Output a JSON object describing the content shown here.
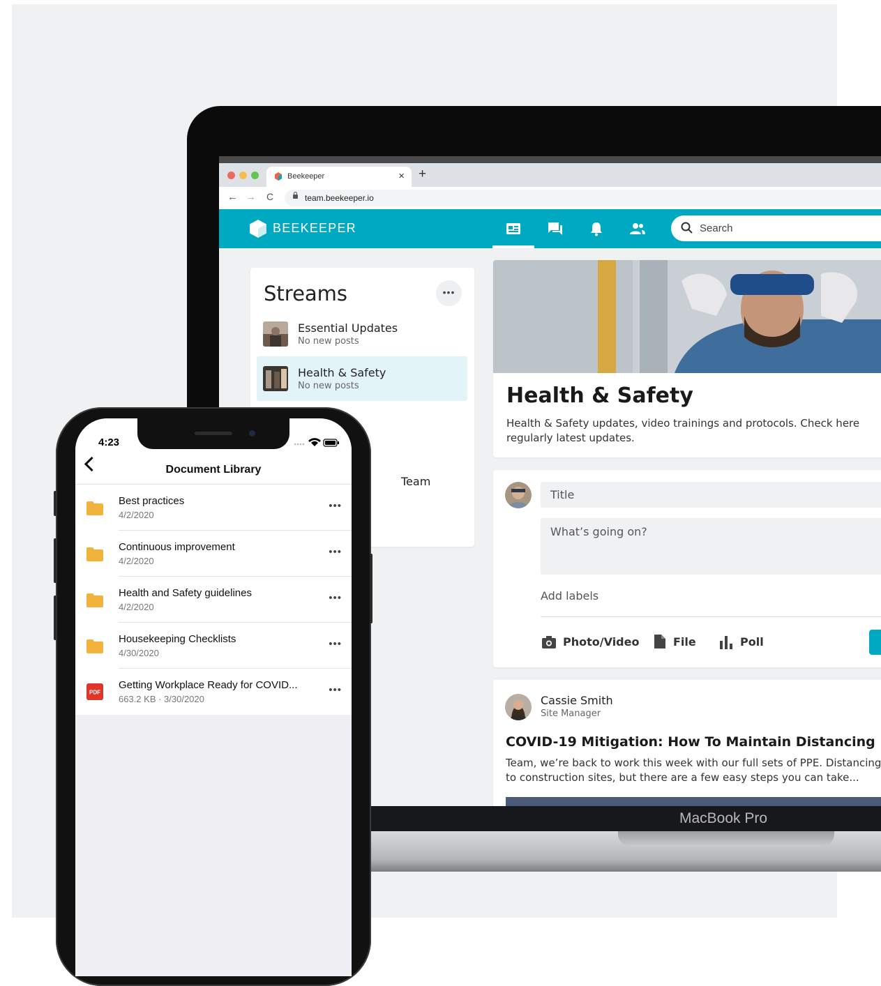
{
  "browser": {
    "tab_title": "Beekeeper",
    "tab_close": "×",
    "tab_new": "+",
    "url": "team.beekeeper.io",
    "nav_back": "←",
    "nav_forward": "→",
    "nav_reload": "C"
  },
  "app": {
    "brand": "BEEKEEPER",
    "brand_color": "#00a9c2",
    "nav_icons": [
      "streams-icon",
      "chats-icon",
      "notifications-icon",
      "people-icon"
    ],
    "search_placeholder": "Search"
  },
  "streams": {
    "title": "Streams",
    "more": "•••",
    "items": [
      {
        "name": "Essential Updates",
        "sub": "No new posts"
      },
      {
        "name": "Health & Safety",
        "sub": "No new posts"
      }
    ],
    "partial_item": "Team"
  },
  "hero": {
    "title": "Health & Safety",
    "description": "Health & Safety updates, video trainings and protocols. Check here regularly latest updates."
  },
  "composer": {
    "title_placeholder": "Title",
    "body_placeholder": "What’s going on?",
    "add_labels": "Add labels",
    "actions": [
      "Photo/Video",
      "File",
      "Poll"
    ]
  },
  "post": {
    "author": "Cassie Smith",
    "role": "Site Manager",
    "title": "COVID-19 Mitigation: How To Maintain Distancing",
    "body": "Team, we’re back to work this week with our full sets of PPE. Distancing is to construction sites, but there are a few easy steps you can take..."
  },
  "laptop_label": "MacBook Pro",
  "phone": {
    "time": "4:23",
    "title": "Document Library",
    "items": [
      {
        "name": "Best practices",
        "sub": "4/2/2020",
        "icon": "folder-icon"
      },
      {
        "name": "Continuous improvement",
        "sub": "4/2/2020",
        "icon": "folder-icon"
      },
      {
        "name": "Health and Safety guidelines",
        "sub": "4/2/2020",
        "icon": "folder-icon"
      },
      {
        "name": "Housekeeping Checklists",
        "sub": "4/30/2020",
        "icon": "folder-icon"
      },
      {
        "name": "Getting Workplace Ready for COVID...",
        "sub": "663.2 KB · 3/30/2020",
        "icon": "pdf-icon",
        "icon_label": "PDF"
      }
    ],
    "more": "•••"
  }
}
